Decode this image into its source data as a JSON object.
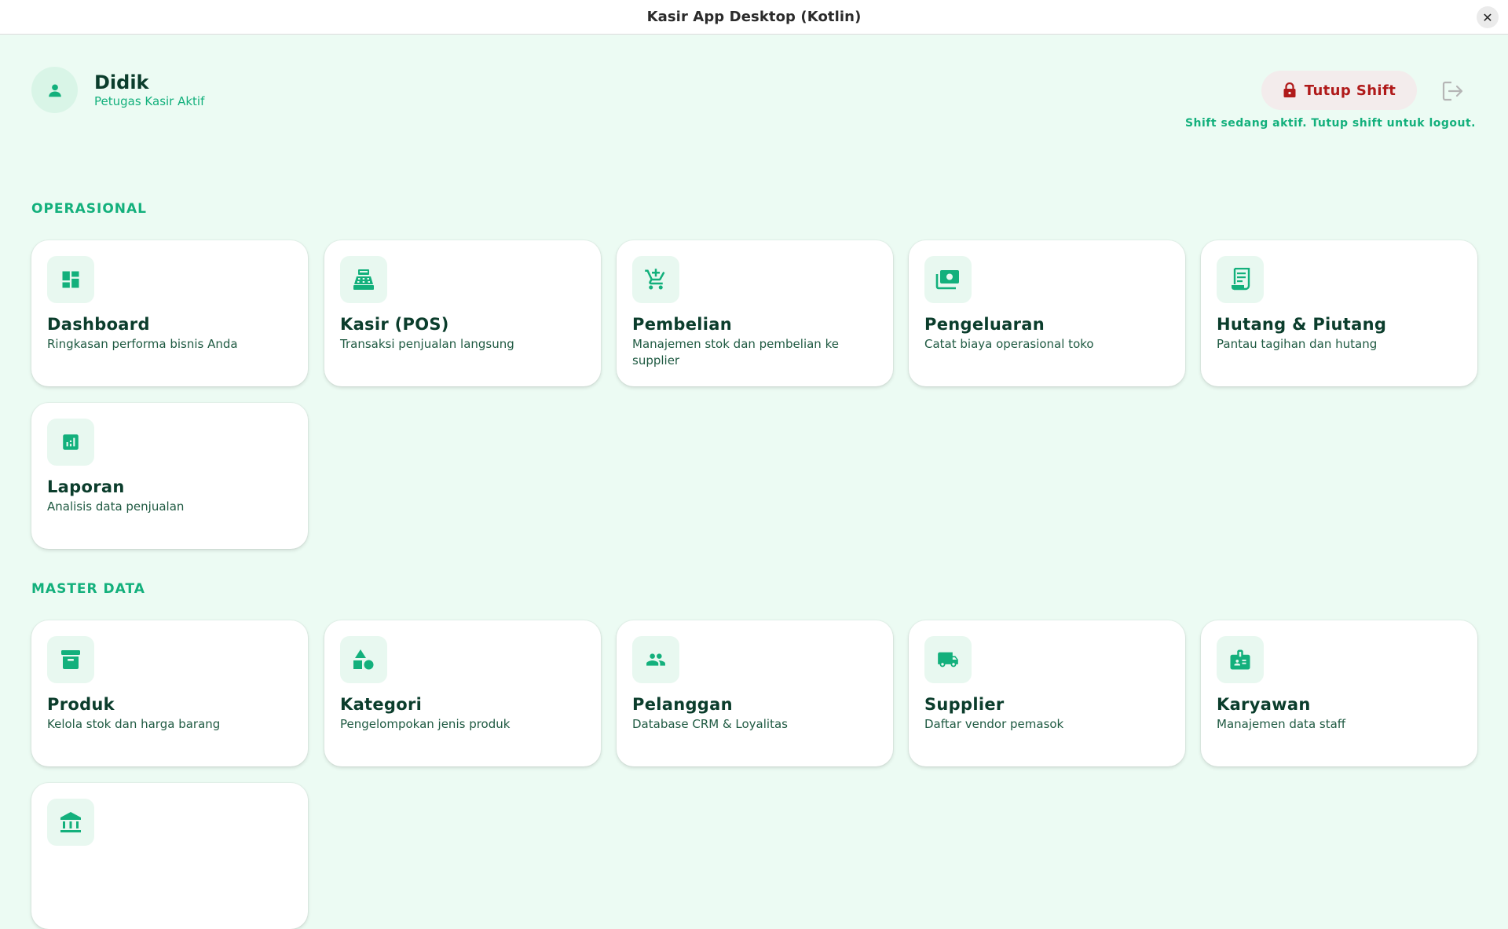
{
  "window": {
    "title": "Kasir App Desktop (Kotlin)",
    "close_glyph": "✕"
  },
  "user": {
    "name": "Didik",
    "role": "Petugas Kasir Aktif",
    "avatar_icon": "person-icon"
  },
  "shift": {
    "button_label": "Tutup Shift",
    "button_icon": "lock-icon",
    "logout_icon": "logout-icon",
    "note": "Shift sedang aktif. Tutup shift untuk logout."
  },
  "colors": {
    "accent": "#13b07c",
    "dark_text": "#0b3d2c",
    "background": "#ecfbf3",
    "danger": "#b01a1a"
  },
  "sections": [
    {
      "title": "OPERASIONAL",
      "cards": [
        {
          "title": "Dashboard",
          "desc": "Ringkasan performa bisnis Anda",
          "icon": "dashboard-icon"
        },
        {
          "title": "Kasir (POS)",
          "desc": "Transaksi penjualan langsung",
          "icon": "cash-register-icon"
        },
        {
          "title": "Pembelian",
          "desc": "Manajemen stok dan pembelian ke supplier",
          "icon": "add-cart-icon"
        },
        {
          "title": "Pengeluaran",
          "desc": "Catat biaya operasional toko",
          "icon": "money-icon"
        },
        {
          "title": "Hutang & Piutang",
          "desc": "Pantau tagihan dan hutang",
          "icon": "receipt-icon"
        },
        {
          "title": "Laporan",
          "desc": "Analisis data penjualan",
          "icon": "bar-chart-icon"
        }
      ]
    },
    {
      "title": "MASTER DATA",
      "cards": [
        {
          "title": "Produk",
          "desc": "Kelola stok dan harga barang",
          "icon": "archive-box-icon"
        },
        {
          "title": "Kategori",
          "desc": "Pengelompokan jenis produk",
          "icon": "category-shapes-icon"
        },
        {
          "title": "Pelanggan",
          "desc": "Database CRM & Loyalitas",
          "icon": "people-icon"
        },
        {
          "title": "Supplier",
          "desc": "Daftar vendor pemasok",
          "icon": "truck-icon"
        },
        {
          "title": "Karyawan",
          "desc": "Manajemen data staff",
          "icon": "badge-icon"
        },
        {
          "title": "",
          "desc": "",
          "icon": "bank-icon"
        }
      ]
    }
  ]
}
